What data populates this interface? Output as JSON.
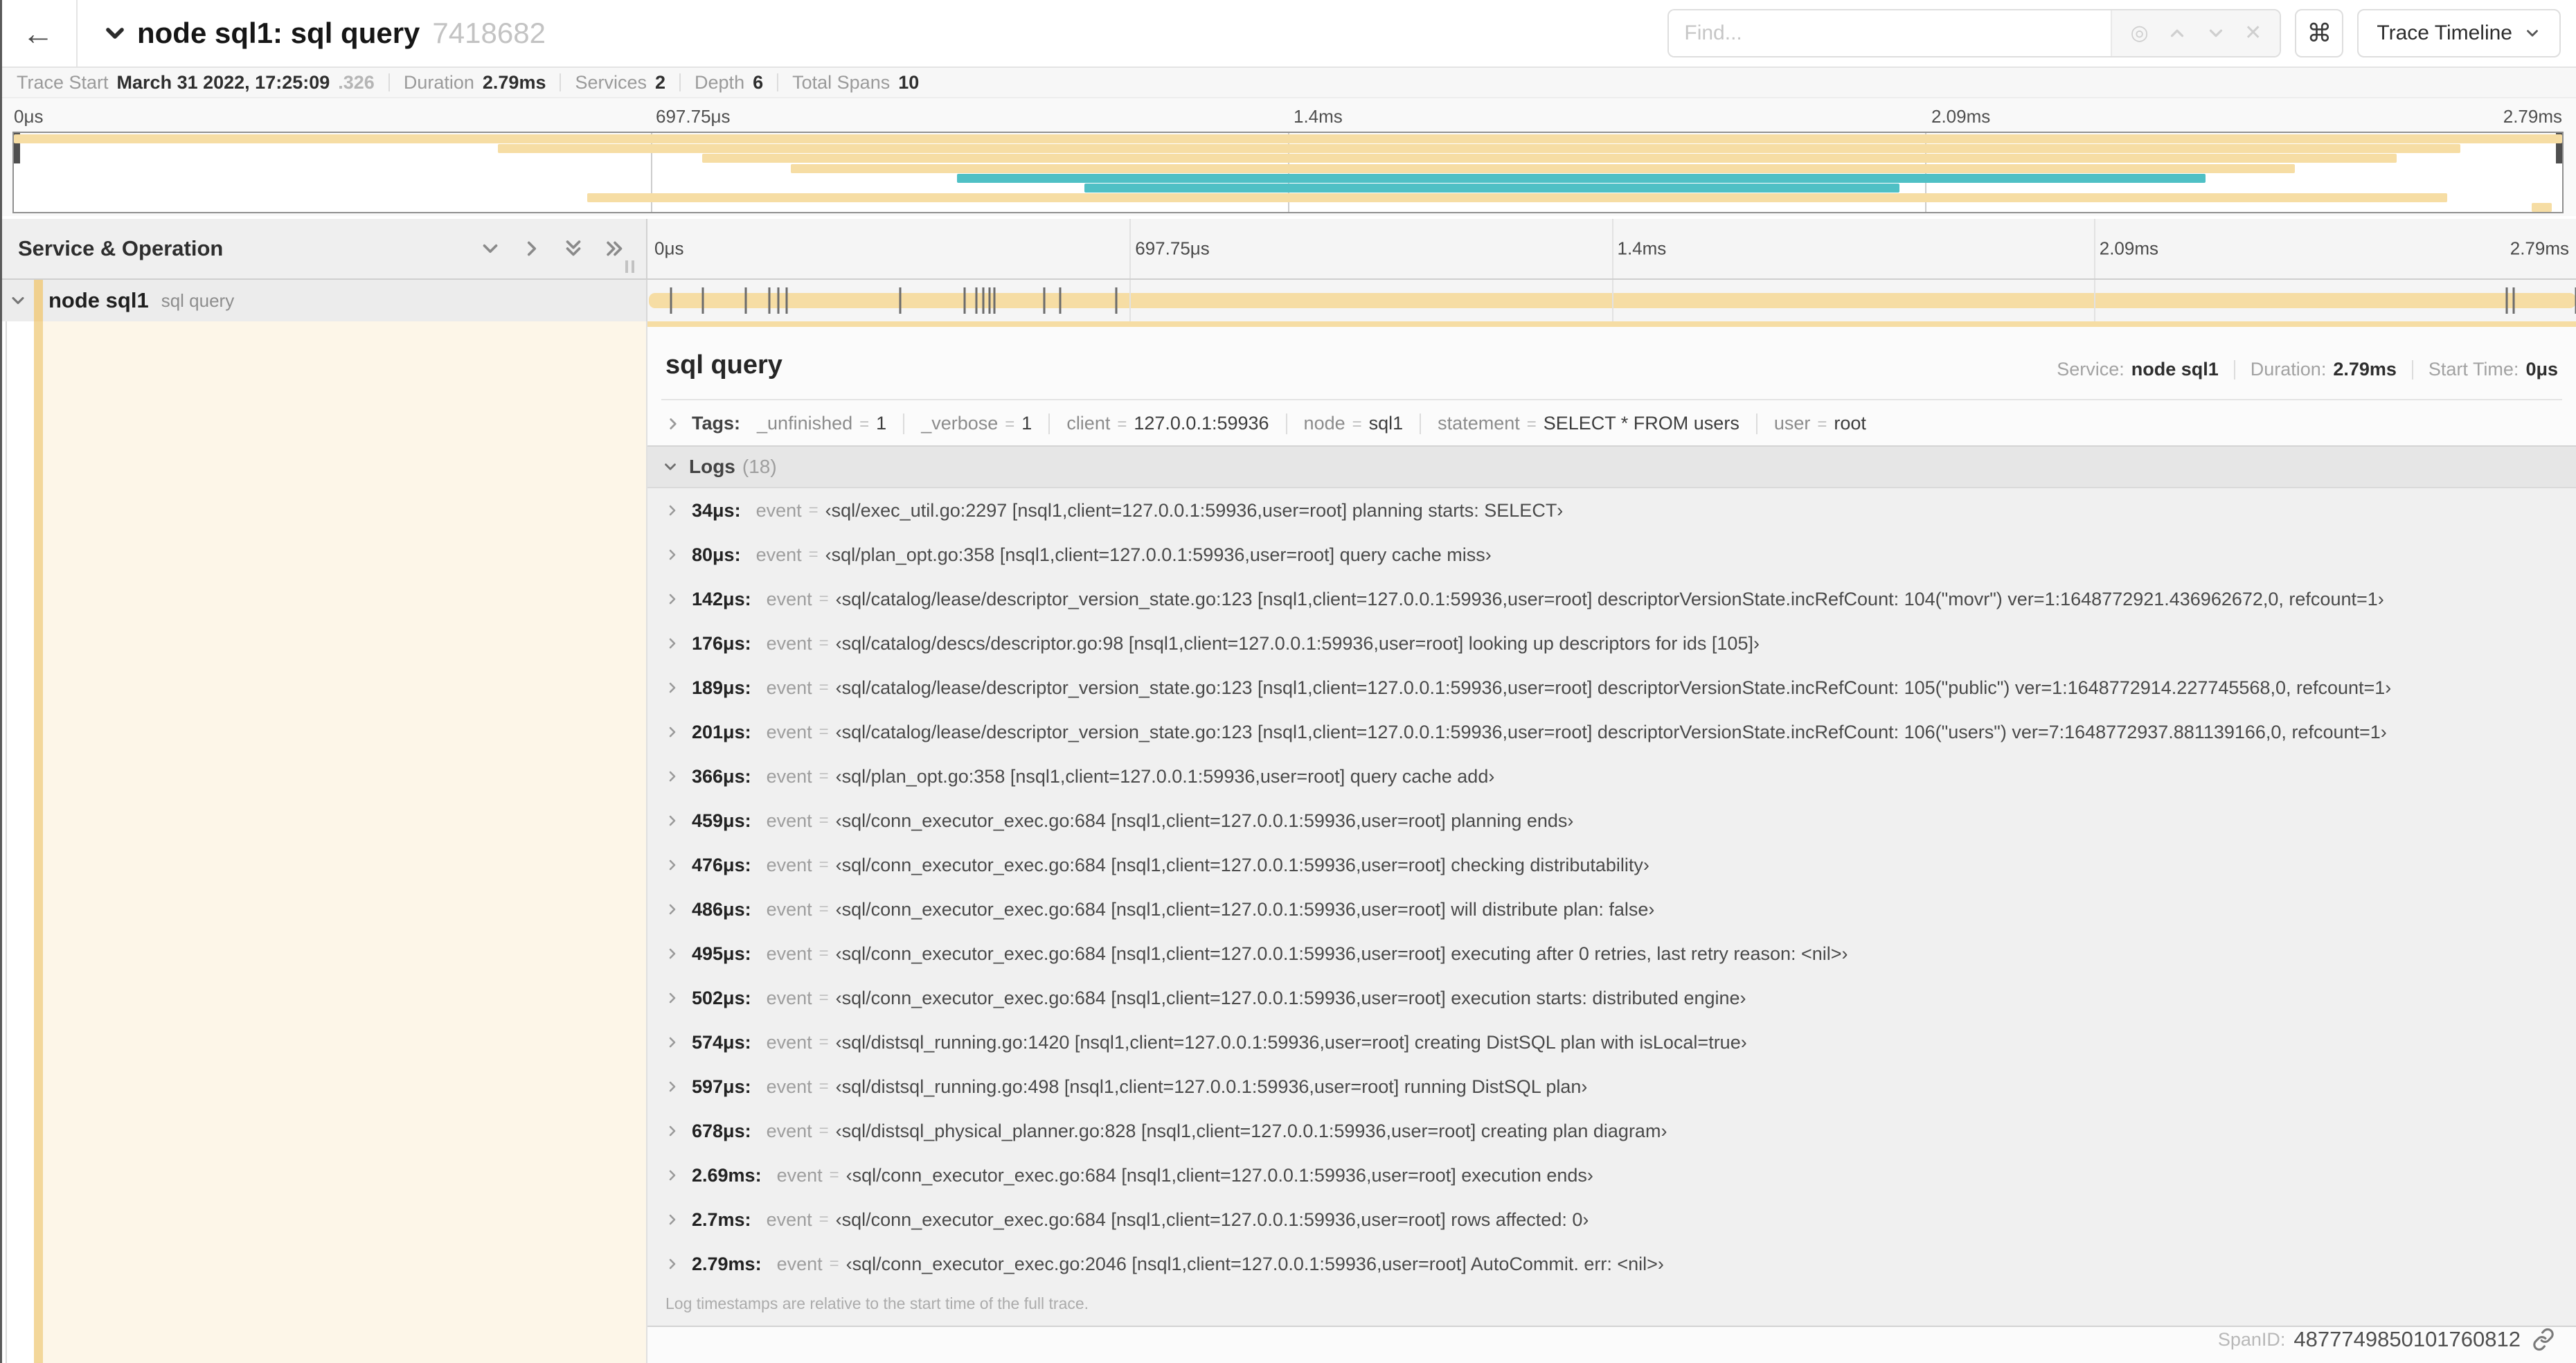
{
  "header": {
    "back_glyph": "←",
    "title": "node sql1: sql query",
    "trace_id": "7418682",
    "find_placeholder": "Find...",
    "cmd_glyph": "⌘",
    "view_selector": "Trace Timeline",
    "find_tool_icons": [
      "locate-icon",
      "chevron-up-icon",
      "chevron-down-icon",
      "clear-icon"
    ],
    "locate_glyph": "◎",
    "clear_glyph": "✕"
  },
  "meta": {
    "items": [
      {
        "label": "Trace Start",
        "value": "March 31 2022, 17:25:09",
        "suffix": ".326"
      },
      {
        "label": "Duration",
        "value": "2.79ms",
        "suffix": ""
      },
      {
        "label": "Services",
        "value": "2",
        "suffix": ""
      },
      {
        "label": "Depth",
        "value": "6",
        "suffix": ""
      },
      {
        "label": "Total Spans",
        "value": "10",
        "suffix": ""
      }
    ]
  },
  "ruler": {
    "ticks": [
      "0μs",
      "697.75μs",
      "1.4ms",
      "2.09ms",
      "2.79ms"
    ],
    "percents": [
      0,
      25,
      50,
      75,
      100
    ]
  },
  "colors": {
    "tan": "#f6dda4",
    "teal": "#4fc0c5",
    "stripe": "#f3d79a",
    "cream": "#fdf6e8"
  },
  "minimap": {
    "spans": [
      {
        "row": 0,
        "start": 0,
        "end": 100,
        "color": "tan"
      },
      {
        "row": 1,
        "start": 19,
        "end": 96,
        "color": "tan"
      },
      {
        "row": 2,
        "start": 27,
        "end": 93.5,
        "color": "tan"
      },
      {
        "row": 3,
        "start": 30.5,
        "end": 89.5,
        "color": "tan"
      },
      {
        "row": 4,
        "start": 37,
        "end": 86,
        "color": "teal"
      },
      {
        "row": 5,
        "start": 42,
        "end": 74,
        "color": "teal"
      },
      {
        "row": 6,
        "start": 22.5,
        "end": 95.5,
        "color": "tan"
      },
      {
        "row": 7,
        "start": 98.8,
        "end": 99.6,
        "color": "tan"
      }
    ]
  },
  "grid": {
    "left_header": "Service & Operation"
  },
  "span_row": {
    "service": "node sql1",
    "operation": "sql query"
  },
  "detail": {
    "title": "sql query",
    "info": [
      {
        "label": "Service:",
        "value": "node sql1"
      },
      {
        "label": "Duration:",
        "value": "2.79ms"
      },
      {
        "label": "Start Time:",
        "value": "0μs"
      }
    ],
    "tags_label": "Tags:",
    "tags": [
      {
        "key": "_unfinished",
        "value": "1"
      },
      {
        "key": "_verbose",
        "value": "1"
      },
      {
        "key": "client",
        "value": "127.0.0.1:59936"
      },
      {
        "key": "node",
        "value": "sql1"
      },
      {
        "key": "statement",
        "value": "SELECT * FROM users"
      },
      {
        "key": "user",
        "value": "root"
      }
    ],
    "logs_label": "Logs",
    "logs_count": "(18)",
    "duration_us": 2790,
    "logs": [
      {
        "time": "34μs:",
        "t_us": 34,
        "key": "event",
        "value": "‹sql/exec_util.go:2297 [nsql1,client=127.0.0.1:59936,user=root] planning starts: SELECT›"
      },
      {
        "time": "80μs:",
        "t_us": 80,
        "key": "event",
        "value": "‹sql/plan_opt.go:358 [nsql1,client=127.0.0.1:59936,user=root] query cache miss›"
      },
      {
        "time": "142μs:",
        "t_us": 142,
        "key": "event",
        "value": "‹sql/catalog/lease/descriptor_version_state.go:123 [nsql1,client=127.0.0.1:59936,user=root] descriptorVersionState.incRefCount: 104(\"movr\") ver=1:1648772921.436962672,0, refcount=1›"
      },
      {
        "time": "176μs:",
        "t_us": 176,
        "key": "event",
        "value": "‹sql/catalog/descs/descriptor.go:98 [nsql1,client=127.0.0.1:59936,user=root] looking up descriptors for ids [105]›"
      },
      {
        "time": "189μs:",
        "t_us": 189,
        "key": "event",
        "value": "‹sql/catalog/lease/descriptor_version_state.go:123 [nsql1,client=127.0.0.1:59936,user=root] descriptorVersionState.incRefCount: 105(\"public\") ver=1:1648772914.227745568,0, refcount=1›"
      },
      {
        "time": "201μs:",
        "t_us": 201,
        "key": "event",
        "value": "‹sql/catalog/lease/descriptor_version_state.go:123 [nsql1,client=127.0.0.1:59936,user=root] descriptorVersionState.incRefCount: 106(\"users\") ver=7:1648772937.881139166,0, refcount=1›"
      },
      {
        "time": "366μs:",
        "t_us": 366,
        "key": "event",
        "value": "‹sql/plan_opt.go:358 [nsql1,client=127.0.0.1:59936,user=root] query cache add›"
      },
      {
        "time": "459μs:",
        "t_us": 459,
        "key": "event",
        "value": "‹sql/conn_executor_exec.go:684 [nsql1,client=127.0.0.1:59936,user=root] planning ends›"
      },
      {
        "time": "476μs:",
        "t_us": 476,
        "key": "event",
        "value": "‹sql/conn_executor_exec.go:684 [nsql1,client=127.0.0.1:59936,user=root] checking distributability›"
      },
      {
        "time": "486μs:",
        "t_us": 486,
        "key": "event",
        "value": "‹sql/conn_executor_exec.go:684 [nsql1,client=127.0.0.1:59936,user=root] will distribute plan: false›"
      },
      {
        "time": "495μs:",
        "t_us": 495,
        "key": "event",
        "value": "‹sql/conn_executor_exec.go:684 [nsql1,client=127.0.0.1:59936,user=root] executing after 0 retries, last retry reason: <nil>›"
      },
      {
        "time": "502μs:",
        "t_us": 502,
        "key": "event",
        "value": "‹sql/conn_executor_exec.go:684 [nsql1,client=127.0.0.1:59936,user=root] execution starts: distributed engine›"
      },
      {
        "time": "574μs:",
        "t_us": 574,
        "key": "event",
        "value": "‹sql/distsql_running.go:1420 [nsql1,client=127.0.0.1:59936,user=root] creating DistSQL plan with isLocal=true›"
      },
      {
        "time": "597μs:",
        "t_us": 597,
        "key": "event",
        "value": "‹sql/distsql_running.go:498 [nsql1,client=127.0.0.1:59936,user=root] running DistSQL plan›"
      },
      {
        "time": "678μs:",
        "t_us": 678,
        "key": "event",
        "value": "‹sql/distsql_physical_planner.go:828 [nsql1,client=127.0.0.1:59936,user=root] creating plan diagram›"
      },
      {
        "time": "2.69ms:",
        "t_us": 2690,
        "key": "event",
        "value": "‹sql/conn_executor_exec.go:684 [nsql1,client=127.0.0.1:59936,user=root] execution ends›"
      },
      {
        "time": "2.7ms:",
        "t_us": 2700,
        "key": "event",
        "value": "‹sql/conn_executor_exec.go:684 [nsql1,client=127.0.0.1:59936,user=root] rows affected: 0›"
      },
      {
        "time": "2.79ms:",
        "t_us": 2790,
        "key": "event",
        "value": "‹sql/conn_executor_exec.go:2046 [nsql1,client=127.0.0.1:59936,user=root] AutoCommit. err: <nil>›"
      }
    ],
    "logs_note": "Log timestamps are relative to the start time of the full trace.",
    "spanid_label": "SpanID:",
    "spanid_value": "4877749850101760812"
  }
}
